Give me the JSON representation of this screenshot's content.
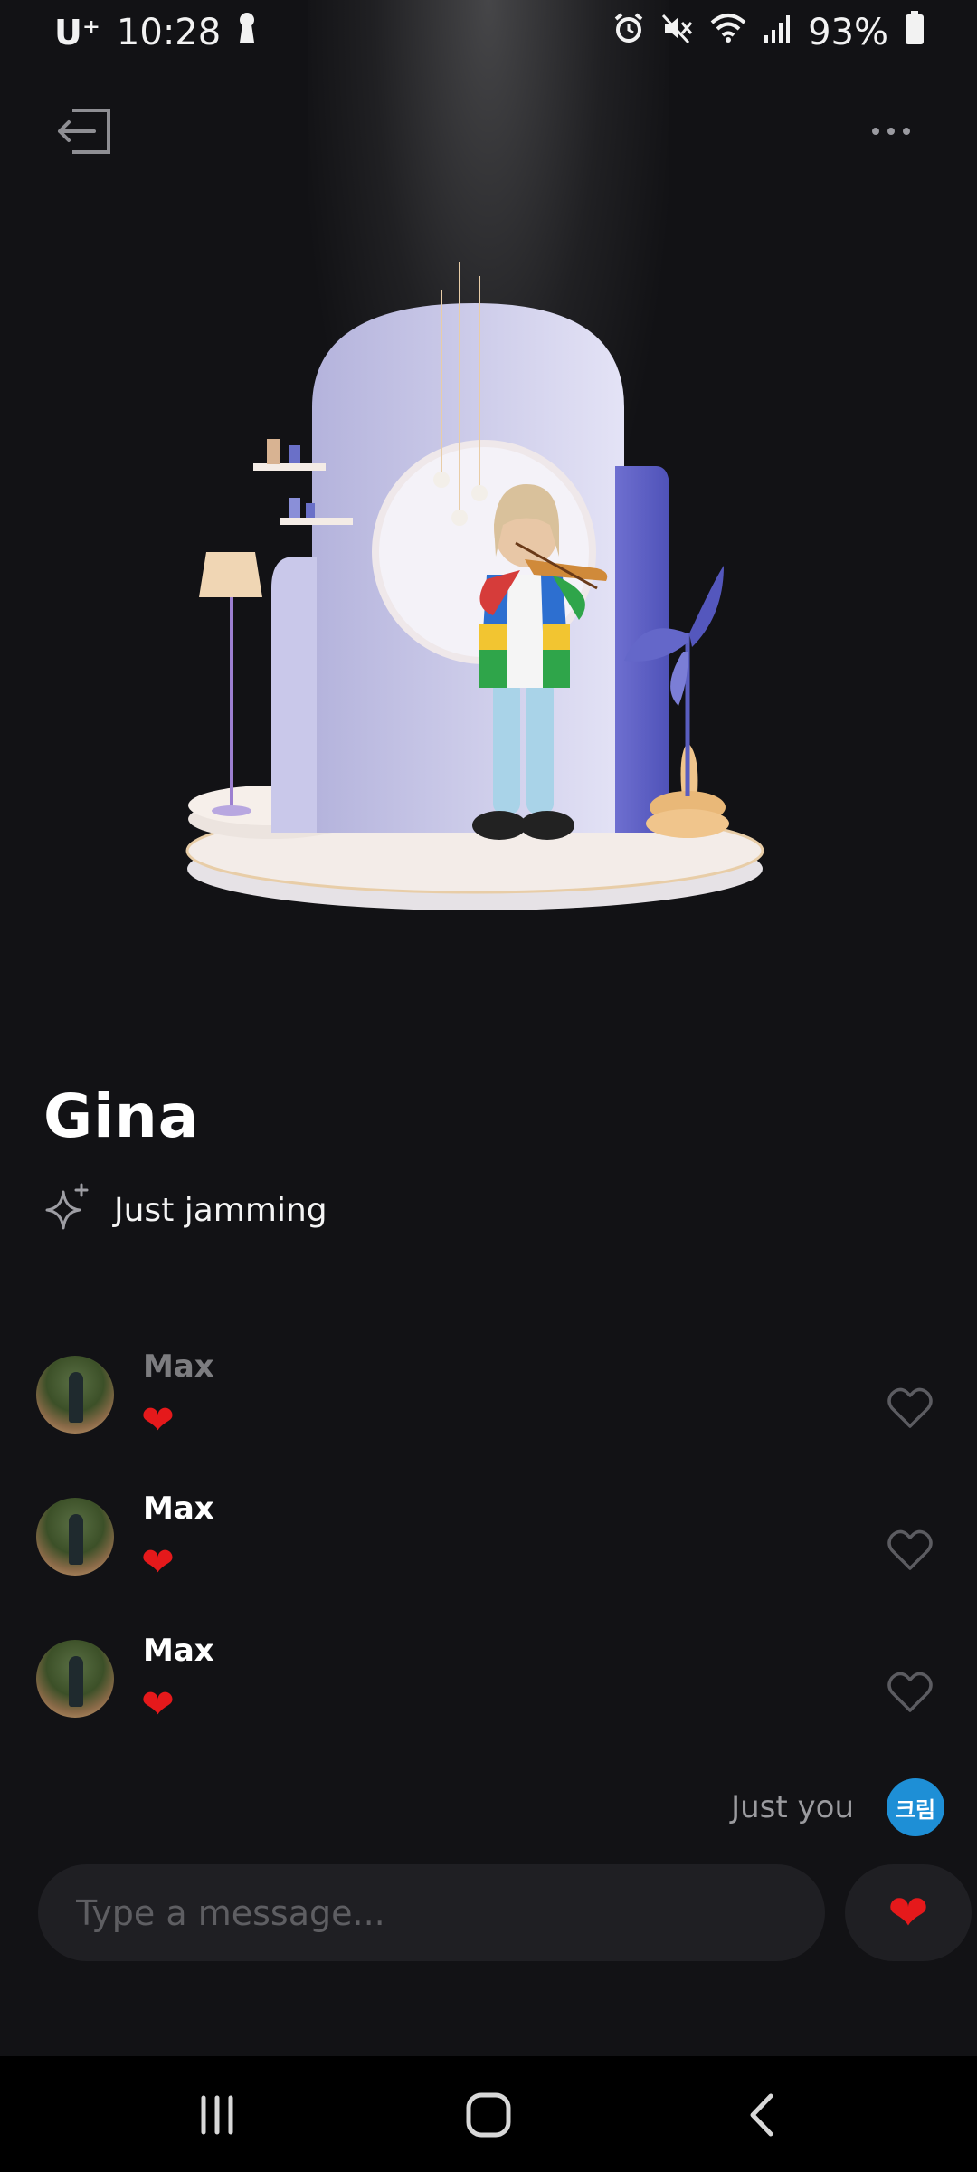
{
  "status_bar": {
    "carrier": "U⁺",
    "time": "10:28",
    "battery": "93%"
  },
  "header": {
    "exit_icon": "exit-icon",
    "more_icon": "more-options-icon"
  },
  "profile": {
    "name": "Gina",
    "status_icon": "sparkle-icon",
    "status": "Just jamming"
  },
  "activity": [
    {
      "sender": "Max",
      "reaction": "❤"
    },
    {
      "sender": "Max",
      "reaction": "❤"
    },
    {
      "sender": "Max",
      "reaction": "❤"
    }
  ],
  "viewers": {
    "label": "Just you",
    "badge": "크림"
  },
  "composer": {
    "placeholder": "Type a message...",
    "send_reaction": "❤"
  },
  "colors": {
    "background": "#121215",
    "accent_blue": "#1e8fd6",
    "heart_red": "#e5191b"
  }
}
